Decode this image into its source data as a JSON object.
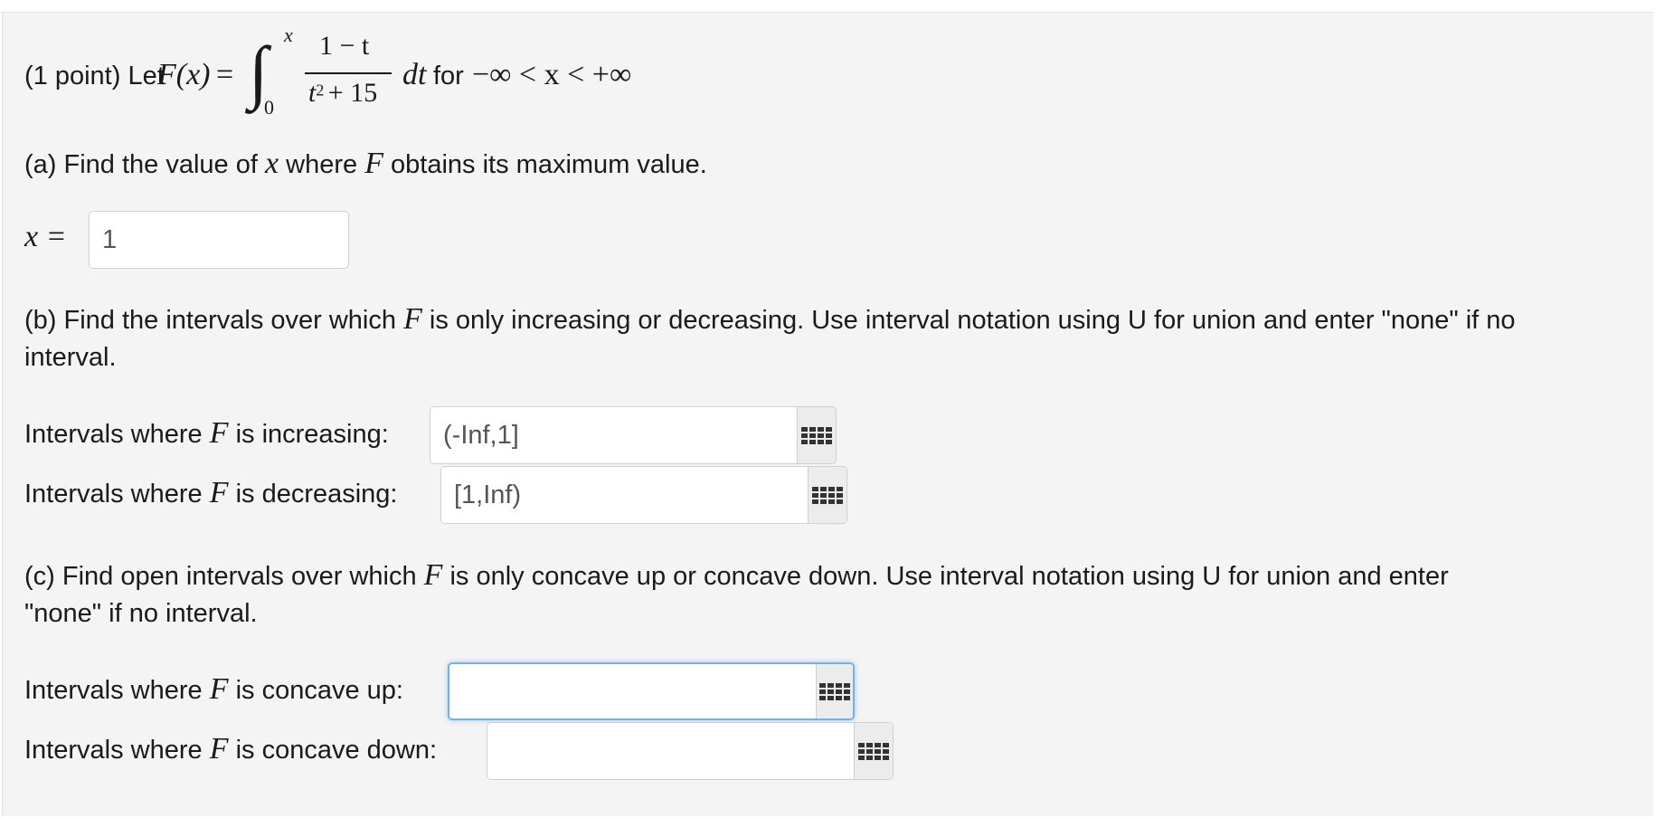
{
  "intro": {
    "points": "(1 point) Let",
    "func": "F(x)",
    "eq": "=",
    "int_upper": "x",
    "int_lower": "0",
    "numerator": "1 − t",
    "denominator_t": "t",
    "denominator_exp": "2",
    "denominator_rest": "+ 15",
    "dt": "dt",
    "for": "for",
    "domain": "−∞ < x < +∞"
  },
  "part_a": {
    "prompt_1": "(a) Find the value of",
    "var_x": "x",
    "prompt_2": "where",
    "var_F": "F",
    "prompt_3": "obtains its maximum value.",
    "answer_label": "x =",
    "answer_value": "1"
  },
  "part_b": {
    "prompt_1": "(b) Find the intervals over which",
    "var_F": "F",
    "prompt_2": "is only increasing or decreasing. Use interval notation using U for union and enter \"none\" if no",
    "prompt_3": "interval.",
    "increasing_label_1": "Intervals where",
    "increasing_var": "F",
    "increasing_label_2": "is increasing:",
    "increasing_value": "(-Inf,1]",
    "decreasing_label_1": "Intervals where",
    "decreasing_var": "F",
    "decreasing_label_2": "is decreasing:",
    "decreasing_value": "[1,Inf)"
  },
  "part_c": {
    "prompt_1": "(c) Find open intervals over which",
    "var_F": "F",
    "prompt_2": "is only concave up or concave down. Use interval notation using U for union and enter",
    "prompt_3": "\"none\" if no interval.",
    "up_label_1": "Intervals where",
    "up_var": "F",
    "up_label_2": "is concave up:",
    "up_value": "",
    "down_label_1": "Intervals where",
    "down_var": "F",
    "down_label_2": "is concave down:",
    "down_value": ""
  },
  "icons": {
    "equation_editor": "keypad-grid-icon"
  },
  "colors": {
    "focus_border": "#6fb3e8",
    "panel_bg": "#f4f4f4"
  }
}
